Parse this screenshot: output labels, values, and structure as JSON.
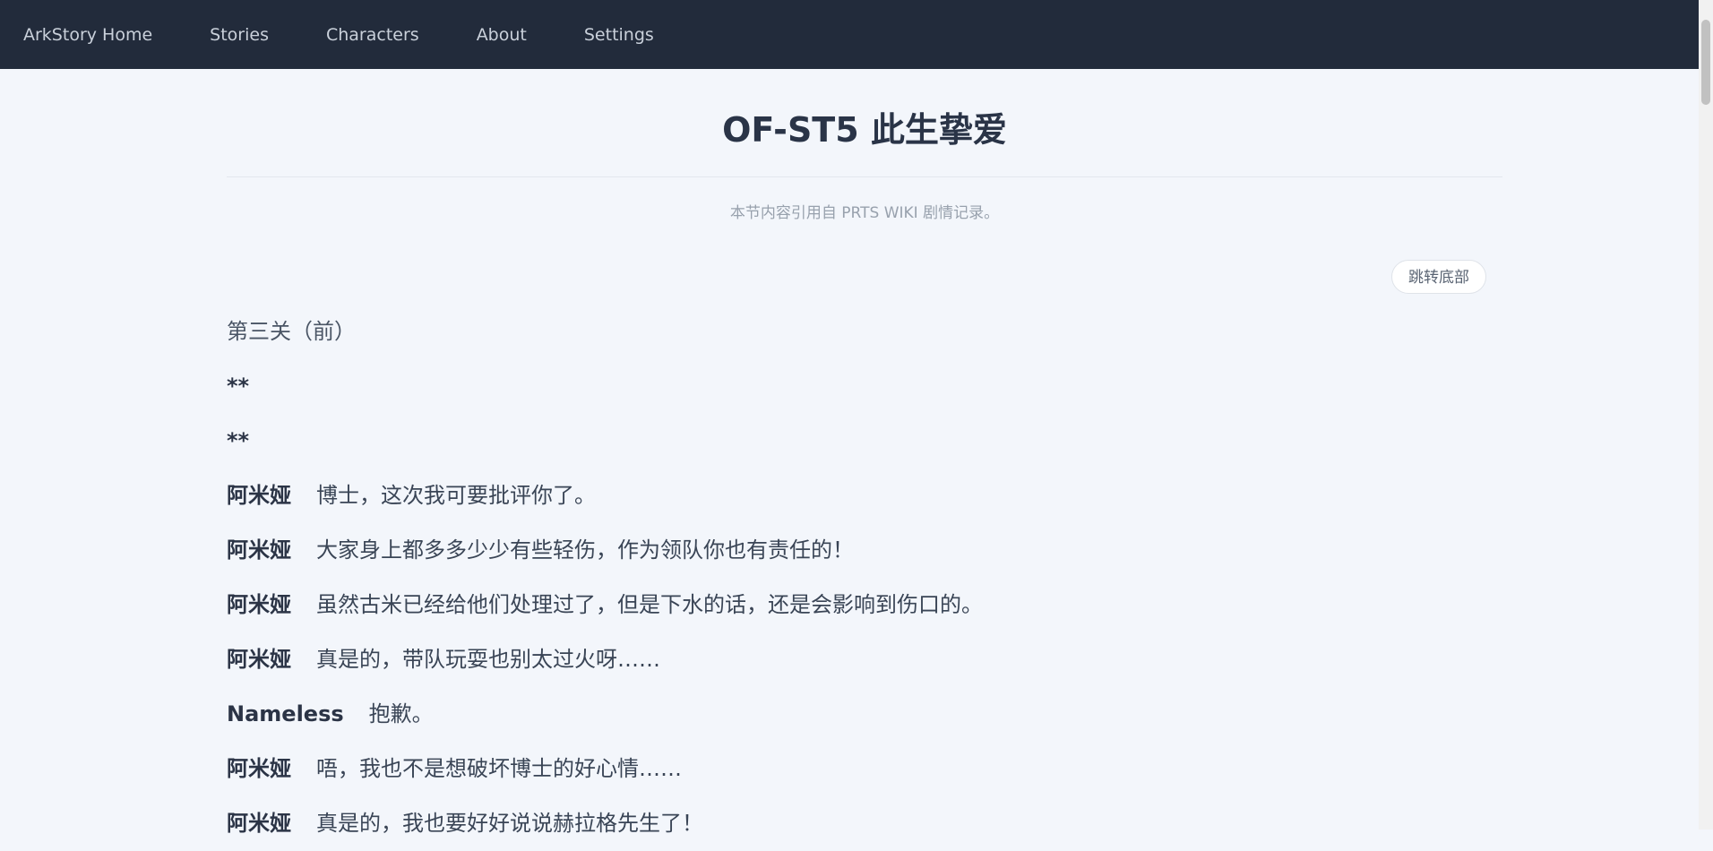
{
  "nav": {
    "items": [
      "ArkStory Home",
      "Stories",
      "Characters",
      "About",
      "Settings"
    ]
  },
  "page": {
    "title": "OF-ST5 此生挚爱",
    "source_note": "本节内容引用自 PRTS WIKI 剧情记录。",
    "jump_label": "跳转底部"
  },
  "story": {
    "section": "第三关（前）",
    "markers": [
      "**",
      "**"
    ],
    "lines": [
      {
        "speaker": "阿米娅",
        "text": "博士，这次我可要批评你了。"
      },
      {
        "speaker": "阿米娅",
        "text": "大家身上都多多少少有些轻伤，作为领队你也有责任的！"
      },
      {
        "speaker": "阿米娅",
        "text": "虽然古米已经给他们处理过了，但是下水的话，还是会影响到伤口的。"
      },
      {
        "speaker": "阿米娅",
        "text": "真是的，带队玩耍也别太过火呀……"
      },
      {
        "speaker": "Nameless",
        "text": "抱歉。"
      },
      {
        "speaker": "阿米娅",
        "text": "唔，我也不是想破坏博士的好心情……"
      },
      {
        "speaker": "阿米娅",
        "text": "真是的，我也要好好说说赫拉格先生了！"
      }
    ]
  }
}
